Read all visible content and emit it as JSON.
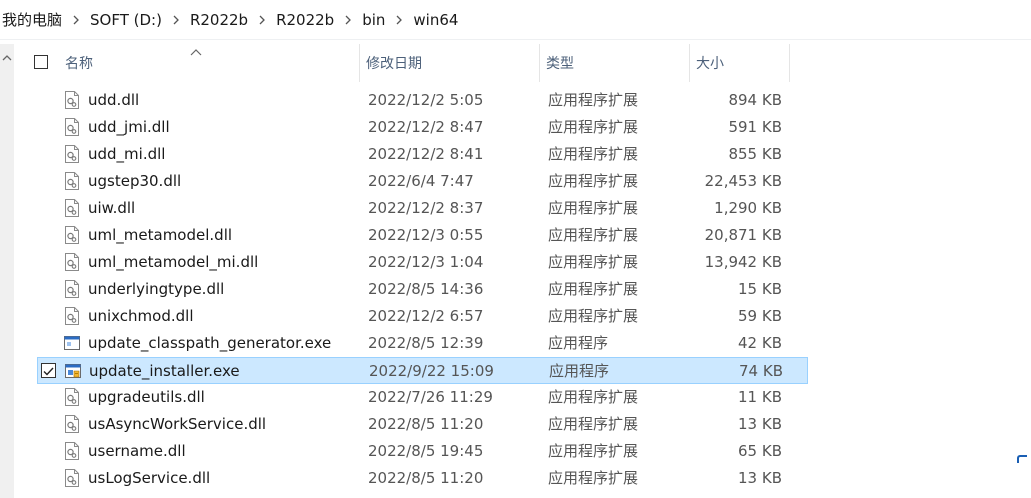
{
  "breadcrumb": [
    {
      "label": "我的电脑"
    },
    {
      "label": "SOFT (D:)"
    },
    {
      "label": "R2022b"
    },
    {
      "label": "R2022b"
    },
    {
      "label": "bin"
    },
    {
      "label": "win64"
    }
  ],
  "columns": {
    "name": "名称",
    "date": "修改日期",
    "type": "类型",
    "size": "大小"
  },
  "files": [
    {
      "name": "udd.dll",
      "date": "2022/12/2 5:05",
      "type": "应用程序扩展",
      "size": "894 KB",
      "icon": "dll-file-icon"
    },
    {
      "name": "udd_jmi.dll",
      "date": "2022/12/2 8:47",
      "type": "应用程序扩展",
      "size": "591 KB",
      "icon": "dll-file-icon"
    },
    {
      "name": "udd_mi.dll",
      "date": "2022/12/2 8:41",
      "type": "应用程序扩展",
      "size": "855 KB",
      "icon": "dll-file-icon"
    },
    {
      "name": "ugstep30.dll",
      "date": "2022/6/4 7:47",
      "type": "应用程序扩展",
      "size": "22,453 KB",
      "icon": "dll-file-icon"
    },
    {
      "name": "uiw.dll",
      "date": "2022/12/2 8:37",
      "type": "应用程序扩展",
      "size": "1,290 KB",
      "icon": "dll-file-icon"
    },
    {
      "name": "uml_metamodel.dll",
      "date": "2022/12/3 0:55",
      "type": "应用程序扩展",
      "size": "20,871 KB",
      "icon": "dll-file-icon"
    },
    {
      "name": "uml_metamodel_mi.dll",
      "date": "2022/12/3 1:04",
      "type": "应用程序扩展",
      "size": "13,942 KB",
      "icon": "dll-file-icon"
    },
    {
      "name": "underlyingtype.dll",
      "date": "2022/8/5 14:36",
      "type": "应用程序扩展",
      "size": "15 KB",
      "icon": "dll-file-icon"
    },
    {
      "name": "unixchmod.dll",
      "date": "2022/12/2 6:57",
      "type": "应用程序扩展",
      "size": "59 KB",
      "icon": "dll-file-icon"
    },
    {
      "name": "update_classpath_generator.exe",
      "date": "2022/8/5 12:39",
      "type": "应用程序",
      "size": "42 KB",
      "icon": "exe-file-icon"
    },
    {
      "name": "update_installer.exe",
      "date": "2022/9/22 15:09",
      "type": "应用程序",
      "size": "74 KB",
      "icon": "installer-exe-icon",
      "selected": true
    },
    {
      "name": "upgradeutils.dll",
      "date": "2022/7/26 11:29",
      "type": "应用程序扩展",
      "size": "11 KB",
      "icon": "dll-file-icon"
    },
    {
      "name": "usAsyncWorkService.dll",
      "date": "2022/8/5 11:20",
      "type": "应用程序扩展",
      "size": "13 KB",
      "icon": "dll-file-icon"
    },
    {
      "name": "username.dll",
      "date": "2022/8/5 19:45",
      "type": "应用程序扩展",
      "size": "65 KB",
      "icon": "dll-file-icon"
    },
    {
      "name": "usLogService.dll",
      "date": "2022/8/5 11:20",
      "type": "应用程序扩展",
      "size": "13 KB",
      "icon": "dll-file-icon"
    }
  ],
  "colors": {
    "selection_bg": "#cce8ff",
    "selection_border": "#99d1ff",
    "header_text": "#4c607a"
  }
}
